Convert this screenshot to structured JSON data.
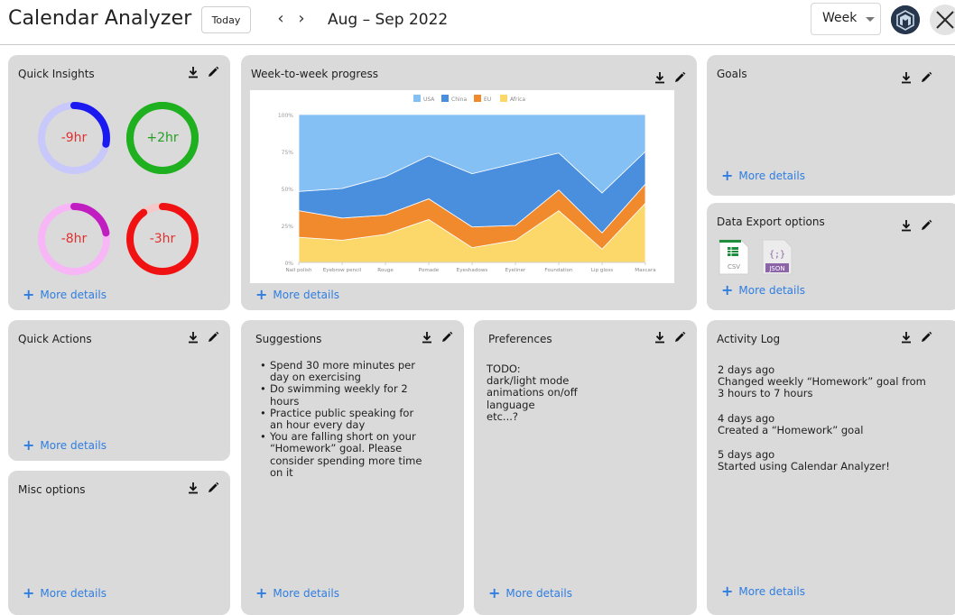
{
  "header": {
    "app_title": "Calendar Analyzer",
    "today_label": "Today",
    "prev_icon": "chevron-left-icon",
    "next_icon": "chevron-right-icon",
    "prev_glyph": "‹",
    "next_glyph": "›",
    "date_range": "Aug – Sep 2022",
    "view_select": "Week",
    "avatar_icon": "logo-avatar-icon",
    "close_icon": "close-icon"
  },
  "common": {
    "more_details": "More details",
    "download_icon": "download-icon",
    "edit_icon": "pencil-icon",
    "plus_glyph": "+"
  },
  "quick_insights": {
    "title": "Quick Insights",
    "rings": [
      {
        "label": "-9hr",
        "progress": 0.28,
        "track_color": "#c8c8fa",
        "arc_color": "#1a1af0",
        "text_color": "#e03030"
      },
      {
        "label": "+2hr",
        "progress": 1.0,
        "track_color": "#1fb01f",
        "arc_color": "#1fb01f",
        "text_color": "#22a022"
      },
      {
        "label": "-8hr",
        "progress": 0.22,
        "track_color": "#f7b7f7",
        "arc_color": "#c01ec0",
        "text_color": "#e03030"
      },
      {
        "label": "-3hr",
        "progress": 0.9,
        "track_color": "#f5c9c9",
        "arc_color": "#f01212",
        "text_color": "#e03030"
      }
    ]
  },
  "progress_card": {
    "title": "Week-to-week progress"
  },
  "goals": {
    "title": "Goals"
  },
  "data_export": {
    "title": "Data Export options",
    "csv_label": "CSV",
    "json_label": "JSON",
    "json_glyph": "{;}"
  },
  "quick_actions": {
    "title": "Quick Actions"
  },
  "misc": {
    "title": "Misc options"
  },
  "suggestions": {
    "title": "Suggestions",
    "items": [
      "Spend 30 more minutes per day on exercising",
      "Do swimming weekly for 2 hours",
      "Practice public speaking for an hour every day",
      "You are falling short on your “Homework” goal. Please consider spending more time on it"
    ]
  },
  "preferences": {
    "title": "Preferences",
    "lines": [
      "TODO:",
      "dark/light mode",
      "animations on/off",
      "language",
      "etc...?"
    ]
  },
  "activity_log": {
    "title": "Activity Log",
    "entries": [
      {
        "when": "2 days ago",
        "what": "Changed weekly “Homework” goal from 3 hours to 7 hours"
      },
      {
        "when": "4 days ago",
        "what": "Created a “Homework” goal"
      },
      {
        "when": "5 days ago",
        "what": "Started using Calendar Analyzer!"
      }
    ]
  },
  "chart_data": {
    "type": "area",
    "stacked": true,
    "percent": true,
    "categories": [
      "Nail polish",
      "Eyebrow pencil",
      "Rouge",
      "Pomade",
      "Eyeshadows",
      "Eyeliner",
      "Foundation",
      "Lip gloss",
      "Mascara"
    ],
    "y_ticks": [
      "0%",
      "25%",
      "50%",
      "75%",
      "100%"
    ],
    "ylim": [
      0,
      100
    ],
    "legend_position": "top",
    "series": [
      {
        "name": "Africa",
        "color": "#fcd86b",
        "values": [
          17,
          15,
          19,
          29,
          10,
          15,
          35,
          9,
          40
        ]
      },
      {
        "name": "EU",
        "color": "#f18a2d",
        "values": [
          18,
          15,
          13,
          14,
          14,
          10,
          14,
          11,
          13
        ]
      },
      {
        "name": "China",
        "color": "#4a8fdd",
        "values": [
          13,
          20,
          26,
          29,
          36,
          42,
          25,
          27,
          22
        ]
      },
      {
        "name": "USA",
        "color": "#85c0f5",
        "values": [
          52,
          50,
          42,
          28,
          40,
          33,
          26,
          53,
          25
        ]
      }
    ],
    "legend_order": [
      "USA",
      "China",
      "EU",
      "Africa"
    ]
  }
}
